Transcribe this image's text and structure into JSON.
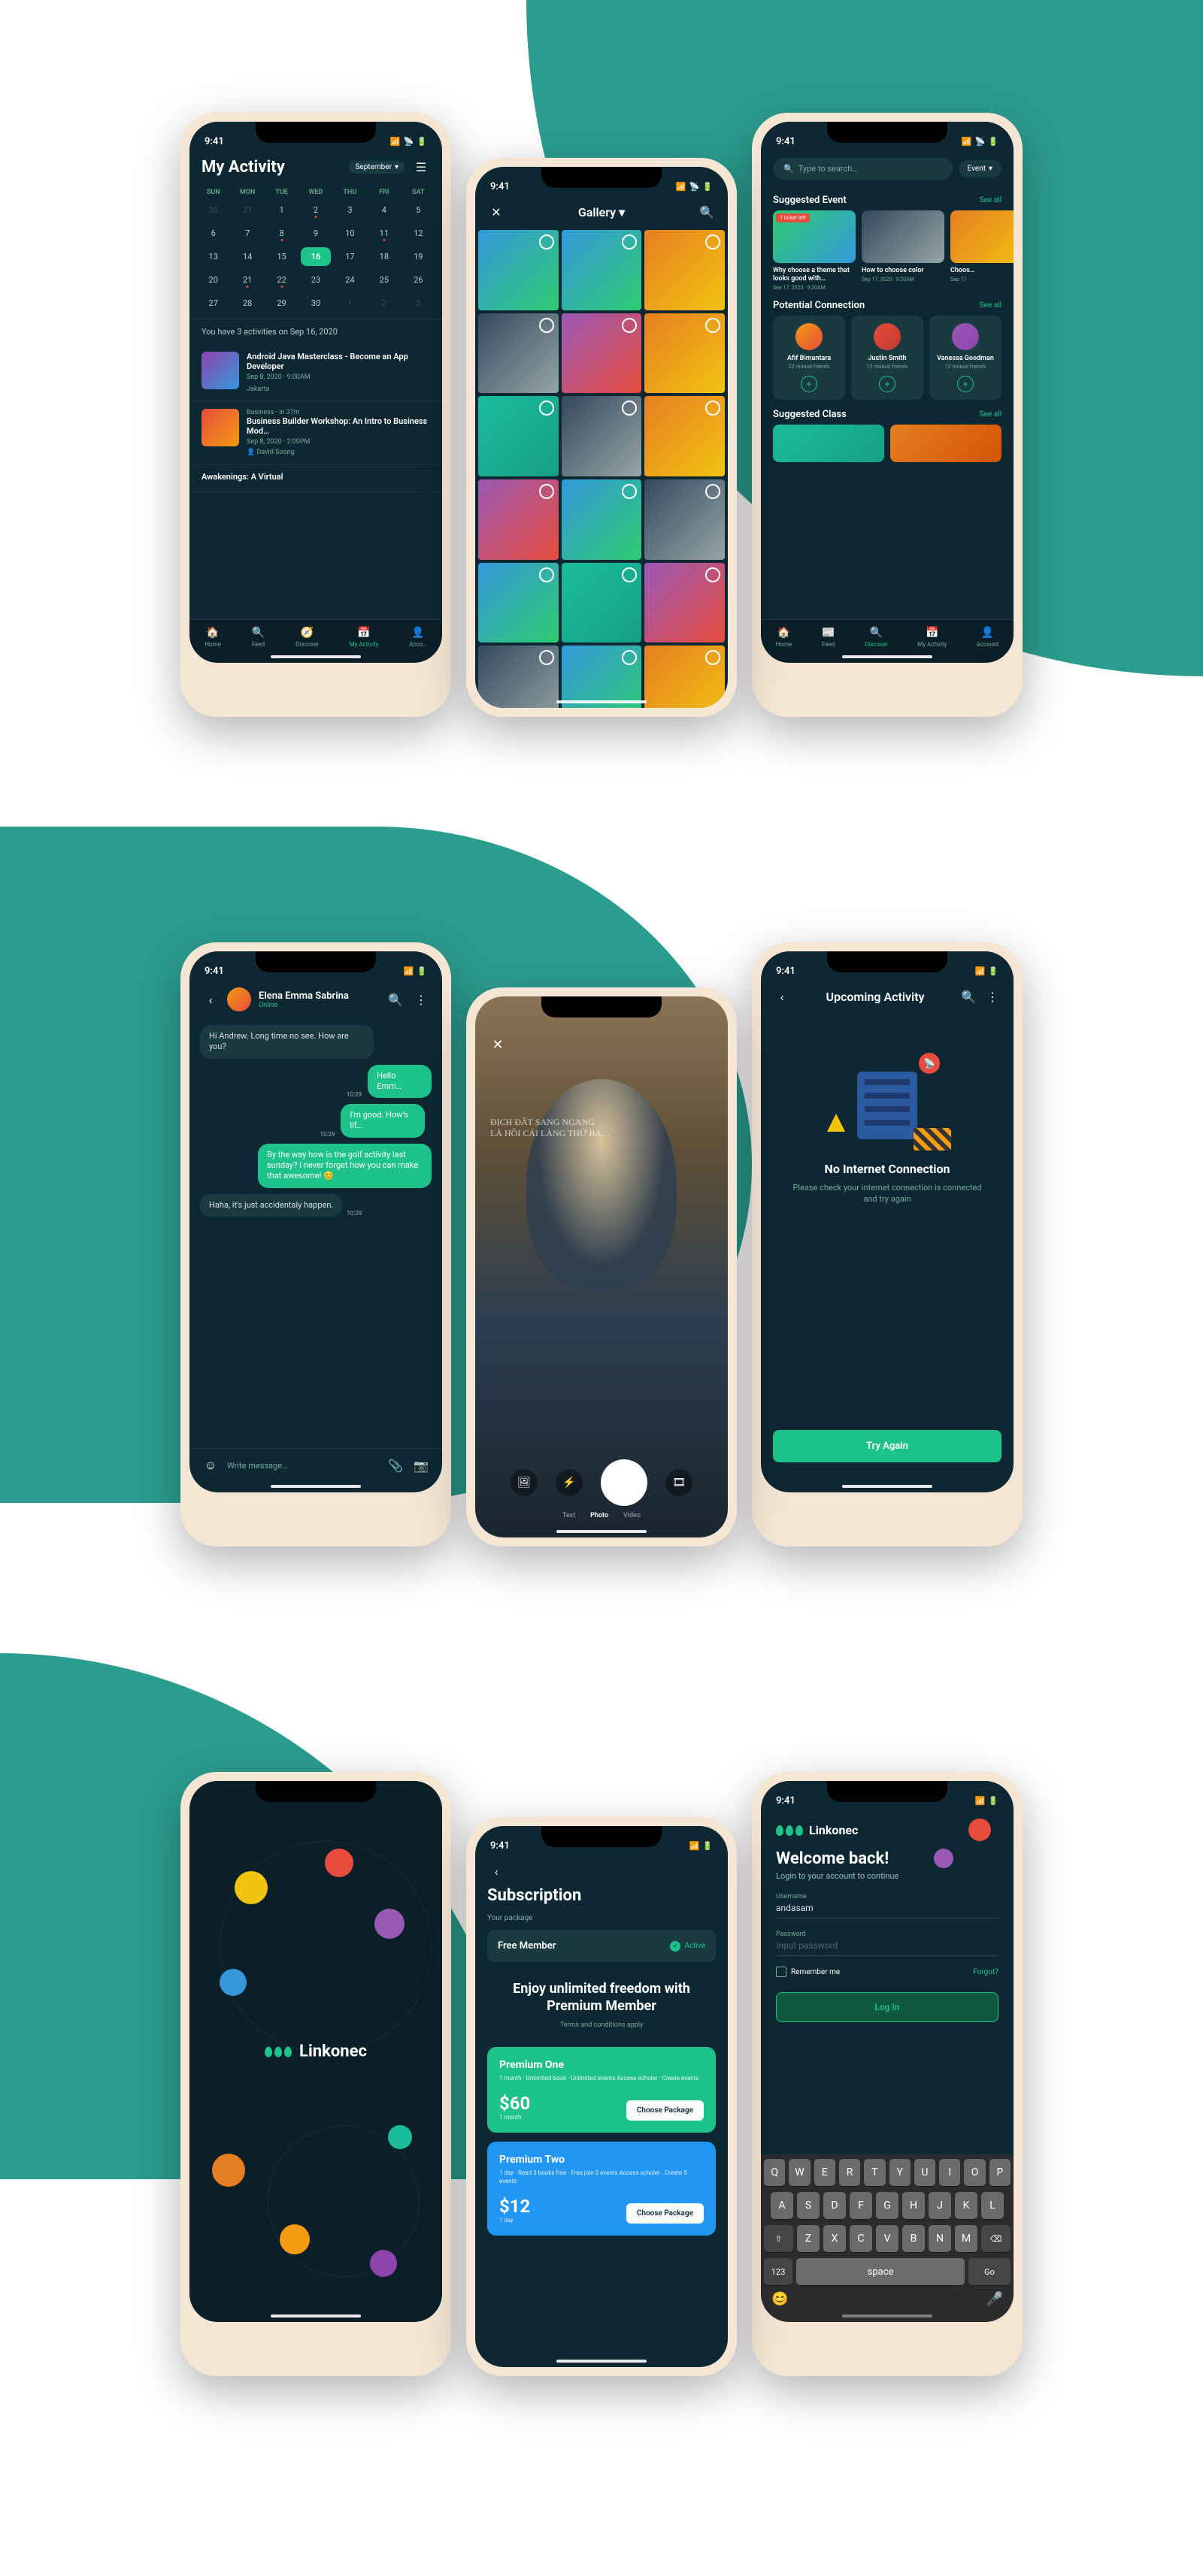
{
  "status_time": "9:41",
  "colors": {
    "accent": "#1ec28b",
    "bg_dark": "#0d2832",
    "teal": "#2a9d8f"
  },
  "activity": {
    "title": "My Activity",
    "month_selector": "September",
    "day_headers": [
      "SUN",
      "MON",
      "TUE",
      "WED",
      "THU",
      "FRI",
      "SAT"
    ],
    "selected_day": 16,
    "notice": "You have 3 activities on Sep 16, 2020",
    "items": [
      {
        "title": "Android Java Masterclass - Become an App Developer",
        "date": "Sep 8, 2020 · 9:00AM",
        "location": "Jakarta"
      },
      {
        "title": "Business Builder Workshop: An Intro to Business Mod…",
        "date": "Sep 8, 2020 · 2:00PM",
        "author": "David Soong",
        "category": "Business · in 37m"
      },
      {
        "title": "Awakenings: A Virtual"
      }
    ],
    "nav": [
      {
        "label": "Home"
      },
      {
        "label": "Feed"
      },
      {
        "label": "Discover"
      },
      {
        "label": "My Activity",
        "active": true
      },
      {
        "label": "Acco…"
      }
    ]
  },
  "gallery": {
    "title": "Gallery"
  },
  "discover": {
    "search_placeholder": "Type to search…",
    "filter": "Event",
    "sections": {
      "events": {
        "title": "Suggested Event",
        "see_all": "See all",
        "badge": "1 ticket left",
        "items": [
          {
            "title": "Why choose a theme that looks good with…",
            "date": "Sep 17, 2020 · 9:20AM"
          },
          {
            "title": "How to choose color",
            "date": "Sep 17, 2020 · 9:20AM"
          },
          {
            "title": "Choos…",
            "date": "Sep 17"
          }
        ]
      },
      "connections": {
        "title": "Potential Connection",
        "see_all": "See all",
        "items": [
          {
            "name": "Afif Bimantara",
            "meta": "23 mutual friends"
          },
          {
            "name": "Justin Smith",
            "meta": "13 mutual friends"
          },
          {
            "name": "Vanessa Goodman",
            "meta": "12 mutual friends"
          }
        ]
      },
      "classes": {
        "title": "Suggested Class",
        "see_all": "See all"
      }
    },
    "nav": [
      {
        "label": "Home"
      },
      {
        "label": "Feed"
      },
      {
        "label": "Discover",
        "active": true
      },
      {
        "label": "My Activity"
      },
      {
        "label": "Account"
      }
    ]
  },
  "chat": {
    "name": "Elena Emma Sabrina",
    "status": "Online",
    "messages": [
      {
        "dir": "in",
        "text": "Hi Andrew. Long time no see. How are you?"
      },
      {
        "dir": "out",
        "time": "10:29",
        "text": "Hello Emm…"
      },
      {
        "dir": "out",
        "time": "10:29",
        "text": "I'm good. How's lif…"
      },
      {
        "dir": "out",
        "text": "By the way how is the golf activity last sunday? I never forget how you can make that awesome! 😊"
      },
      {
        "dir": "in",
        "text": "Haha, it's just accidentaly happen.",
        "time": "10:29"
      }
    ],
    "input_placeholder": "Write message…"
  },
  "camera": {
    "overlay_text_1": "ĐỊCH ĐẤT SANG NGANG",
    "overlay_text_2": "LÀ HỒI CÁI LÀNG THỨ BA…",
    "modes": [
      "Text",
      "Photo",
      "Video"
    ],
    "selected_mode": "Photo"
  },
  "noconn": {
    "header": "Upcoming Activity",
    "title": "No Internet Connection",
    "subtitle": "Please check your internet connection is connected and try again",
    "button": "Try Again"
  },
  "splash": {
    "brand": "Linkonec"
  },
  "subscription": {
    "title": "Subscription",
    "your_package_label": "Your package",
    "current_plan": "Free Member",
    "current_status": "Active",
    "hero_title": "Enjoy unlimited freedom with Premium Member",
    "hero_sub": "Terms and conditions apply",
    "plans": [
      {
        "name": "Premium One",
        "features": "1 month · Unlimited book · Unlimited events\nAccess scholer · Create  events",
        "price": "$60",
        "period": "1 month",
        "cta": "Choose Package"
      },
      {
        "name": "Premium Two",
        "features": "1 day · Read 3 books free · Free join 5 events\nAccess scholer · Create 5 events",
        "price": "$12",
        "period": "1 day",
        "cta": "Choose Package"
      }
    ]
  },
  "login": {
    "brand": "Linkonec",
    "title": "Welcome back!",
    "subtitle": "Login to your account to continue",
    "username_label": "Username",
    "username_value": "andasam",
    "password_label": "Password",
    "password_placeholder": "Input password",
    "remember": "Remember me",
    "forgot": "Forgot?",
    "button": "Log In",
    "keyboard": {
      "row1": [
        "Q",
        "W",
        "E",
        "R",
        "T",
        "Y",
        "U",
        "I",
        "O",
        "P"
      ],
      "row2": [
        "A",
        "S",
        "D",
        "F",
        "G",
        "H",
        "J",
        "K",
        "L"
      ],
      "row3_shift": "⇧",
      "row3": [
        "Z",
        "X",
        "C",
        "V",
        "B",
        "N",
        "M"
      ],
      "row3_del": "⌫",
      "numkey": "123",
      "space": "space",
      "go": "Go"
    }
  }
}
